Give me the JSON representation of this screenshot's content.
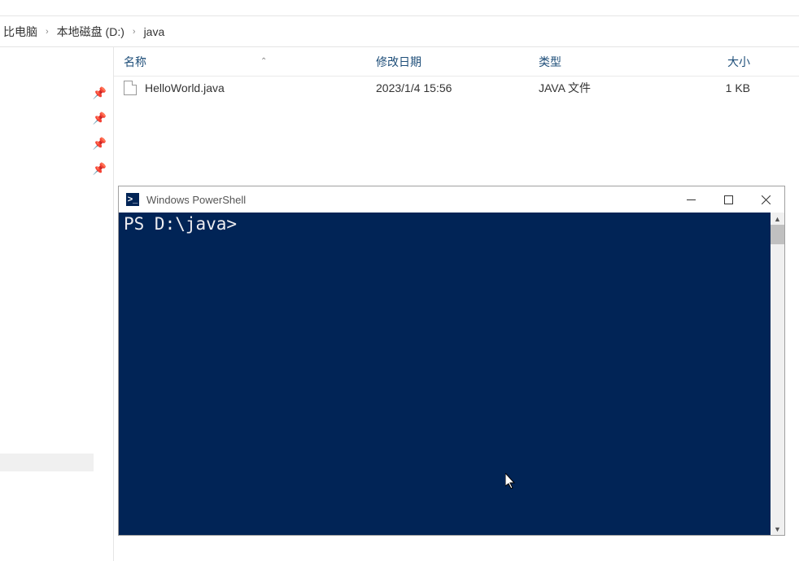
{
  "breadcrumb": {
    "item1": "比电脑",
    "item2": "本地磁盘 (D:)",
    "item3": "java"
  },
  "columns": {
    "name": "名称",
    "date": "修改日期",
    "type": "类型",
    "size": "大小"
  },
  "file": {
    "name": "HelloWorld.java",
    "date": "2023/1/4 15:56",
    "type": "JAVA 文件",
    "size": "1 KB"
  },
  "ps": {
    "title": "Windows PowerShell",
    "prompt": "PS D:\\java> "
  }
}
